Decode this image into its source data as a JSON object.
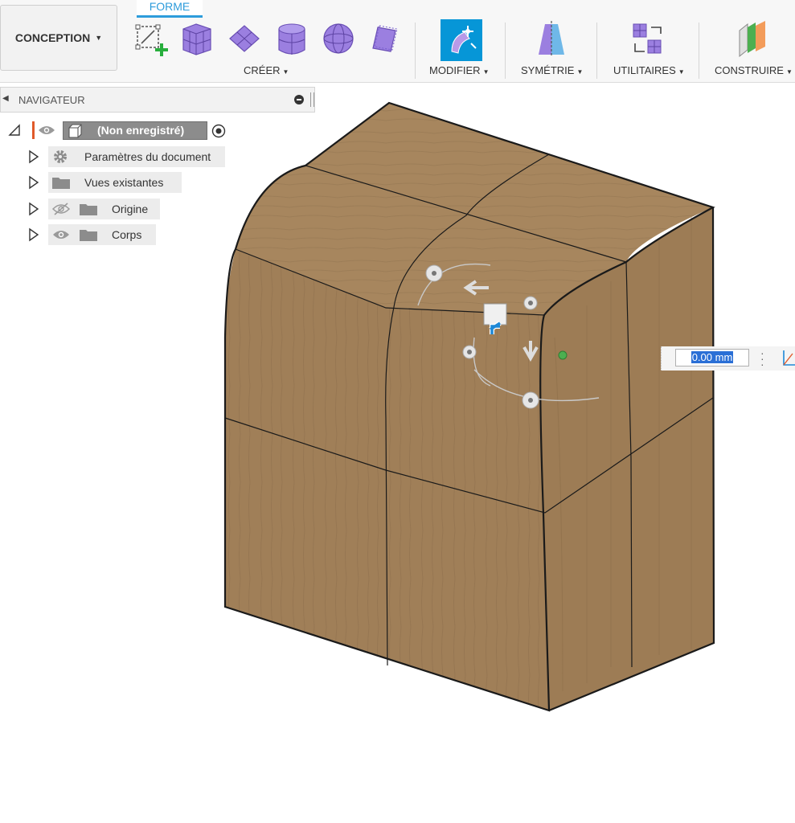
{
  "toolbar": {
    "workspace_label": "CONCEPTION",
    "active_tab": "FORME",
    "groups": [
      {
        "label": "CRÉER"
      },
      {
        "label": "MODIFIER"
      },
      {
        "label": "SYMÉTRIE"
      },
      {
        "label": "UTILITAIRES"
      },
      {
        "label": "CONSTRUIRE"
      }
    ]
  },
  "navigator": {
    "title": "NAVIGATEUR",
    "root": {
      "label": "(Non enregistré)"
    },
    "items": [
      {
        "label": "Paramètres du document",
        "icon": "gear-icon"
      },
      {
        "label": "Vues existantes",
        "icon": "folder-icon"
      },
      {
        "label": "Origine",
        "icon": "folder-icon",
        "visibility": "hidden"
      },
      {
        "label": "Corps",
        "icon": "folder-icon",
        "visibility": "visible"
      }
    ]
  },
  "viewport": {
    "value_input": "0.00 mm"
  },
  "colors": {
    "accent": "#2d9cdb",
    "shape_purple": "#9b7fe0",
    "wood": "#a8875f",
    "highlight": "#2a6fd6"
  }
}
